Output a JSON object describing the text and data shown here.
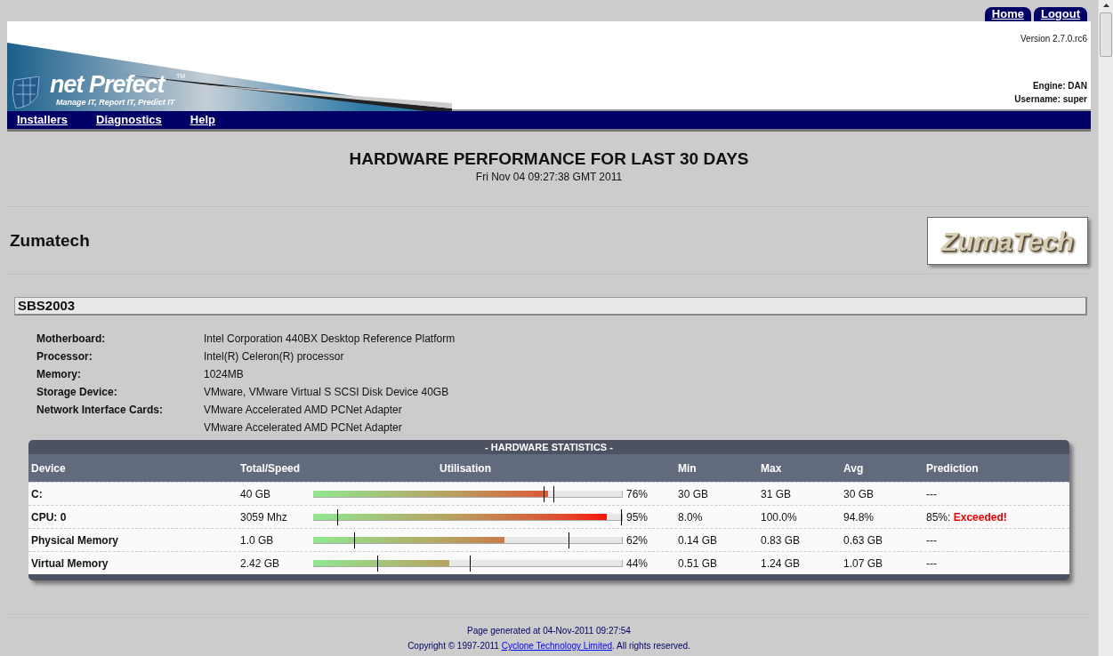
{
  "top_tabs": [
    {
      "label": "Home"
    },
    {
      "label": "Logout"
    }
  ],
  "banner": {
    "logo_name": "net Prefect",
    "logo_tm": "TM",
    "logo_tagline": "Manage IT, Report IT, Predict IT",
    "version": "Version 2.7.0.rc6",
    "engine": "Engine: DAN",
    "username": "Username: super"
  },
  "menu": [
    {
      "label": "Installers"
    },
    {
      "label": "Diagnostics"
    },
    {
      "label": "Help"
    }
  ],
  "title": "HARDWARE PERFORMANCE FOR LAST 30 DAYS",
  "date": "Fri Nov 04 09:27:38 GMT 2011",
  "company": {
    "name": "Zumatech",
    "logo_text": "ZumaTech"
  },
  "server": {
    "name": "SBS2003",
    "details": [
      {
        "label": "Motherboard:",
        "values": [
          "Intel Corporation 440BX Desktop Reference Platform"
        ]
      },
      {
        "label": "Processor:",
        "values": [
          "Intel(R) Celeron(R) processor"
        ]
      },
      {
        "label": "Memory:",
        "values": [
          "1024MB"
        ]
      },
      {
        "label": "Storage Device:",
        "values": [
          "VMware, VMware Virtual S SCSI Disk Device 40GB"
        ]
      },
      {
        "label": "Network Interface Cards:",
        "values": [
          "VMware Accelerated AMD PCNet Adapter",
          "VMware Accelerated AMD PCNet Adapter"
        ]
      }
    ]
  },
  "stats": {
    "title": "- HARDWARE STATISTICS -",
    "columns": [
      "Device",
      "Total/Speed",
      "Utilisation",
      "Min",
      "Max",
      "Avg",
      "Prediction"
    ],
    "rows": [
      {
        "device": "C:",
        "total": "40 GB",
        "utilisation": {
          "level": 0.76
        },
        "min_marker": {
          "level": 0.75
        },
        "max_marker": {
          "level": 0.78
        },
        "percent": "76%",
        "min": "30 GB",
        "max": "31 GB",
        "avg": "30 GB",
        "prediction": "---"
      },
      {
        "device": "CPU: 0",
        "total": "3059 Mhz",
        "utilisation": {
          "level": 0.95
        },
        "min_marker": {
          "level": 0.08
        },
        "max_marker": {
          "level": 1.0
        },
        "percent": "95%",
        "min": "8.0%",
        "max": "100.0%",
        "avg": "94.8%",
        "prediction": "85%:",
        "alert": "Exceeded!"
      },
      {
        "device": "Physical Memory",
        "total": "1.0 GB",
        "utilisation": {
          "level": 0.62
        },
        "min_marker": {
          "level": 0.135
        },
        "max_marker": {
          "level": 0.83
        },
        "percent": "62%",
        "min": "0.14 GB",
        "max": "0.83 GB",
        "avg": "0.63 GB",
        "prediction": "---"
      },
      {
        "device": "Virtual Memory",
        "total": "2.42 GB",
        "utilisation": {
          "level": 0.44
        },
        "min_marker": {
          "level": 0.21
        },
        "max_marker": {
          "level": 0.51
        },
        "percent": "44%",
        "min": "0.51 GB",
        "max": "1.24 GB",
        "avg": "1.07 GB",
        "prediction": "---"
      }
    ]
  },
  "footer": {
    "generated": "Page generated at 04-Nov-2011 09:27:54",
    "copyright_before": "Copyright © 1997-2011",
    "link": "Cyclone Technology Limited",
    "copyright_after": ". All rights reserved."
  }
}
